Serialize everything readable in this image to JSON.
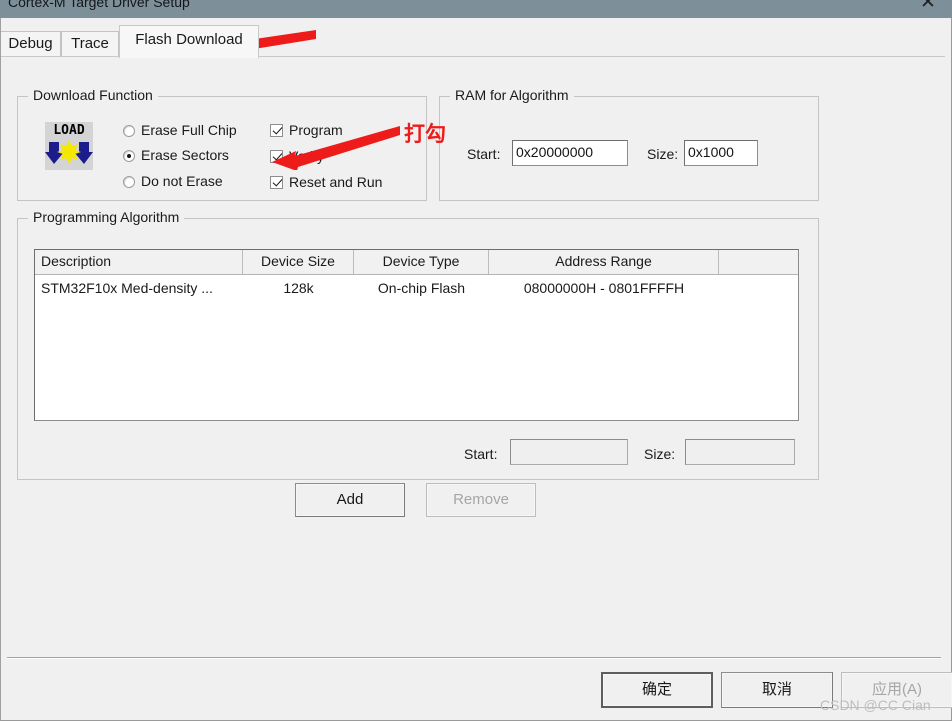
{
  "window": {
    "title": "Cortex-M Target Driver Setup",
    "close_label": "✕"
  },
  "tabs": [
    {
      "id": "debug",
      "label": "Debug",
      "active": false
    },
    {
      "id": "trace",
      "label": "Trace",
      "active": false
    },
    {
      "id": "flash",
      "label": "Flash Download",
      "active": true
    }
  ],
  "download_function": {
    "title": "Download Function",
    "icon_text": "LOAD",
    "radios": [
      {
        "label": "Erase Full Chip",
        "checked": false
      },
      {
        "label": "Erase Sectors",
        "checked": true
      },
      {
        "label": "Do not Erase",
        "checked": false
      }
    ],
    "checkboxes": [
      {
        "label": "Program",
        "checked": true
      },
      {
        "label": "Verify",
        "checked": true
      },
      {
        "label": "Reset and Run",
        "checked": true
      }
    ]
  },
  "ram_for_algorithm": {
    "title": "RAM for Algorithm",
    "start_label": "Start:",
    "start_value": "0x20000000",
    "size_label": "Size:",
    "size_value": "0x1000"
  },
  "programming_algorithm": {
    "title": "Programming Algorithm",
    "columns": [
      "Description",
      "Device Size",
      "Device Type",
      "Address Range",
      ""
    ],
    "rows": [
      {
        "description": "STM32F10x Med-density ...",
        "device_size": "128k",
        "device_type": "On-chip Flash",
        "address_range": "08000000H - 0801FFFFH"
      }
    ],
    "start_label": "Start:",
    "start_value": "",
    "size_label": "Size:",
    "size_value": "",
    "add_label": "Add",
    "remove_label": "Remove",
    "remove_enabled": false
  },
  "footer": {
    "ok_label": "确定",
    "cancel_label": "取消",
    "apply_label": "应用(A)",
    "apply_enabled": false,
    "watermark": "CSDN @CC Cian"
  },
  "annotations": [
    {
      "id": "tab-arrow",
      "text": ""
    },
    {
      "id": "checkbox-arrow",
      "text": "打勾"
    }
  ],
  "colors": {
    "titlebar": "#7d8f98",
    "dialog_background": "#f0f0f0",
    "annotation_red": "#ee1b1b",
    "icon_arrow_blue": "#1c1c8c",
    "icon_star_yellow": "#f5e800"
  }
}
